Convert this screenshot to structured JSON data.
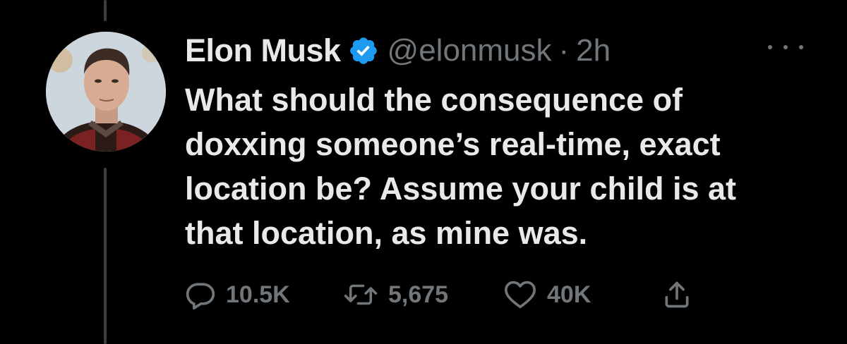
{
  "tweet": {
    "author": {
      "display_name": "Elon Musk",
      "handle": "@elonmusk",
      "verified_icon": "verified-badge-icon",
      "avatar": "profile-photo"
    },
    "separator": "·",
    "timestamp": "2h",
    "more_icon": "more-options-icon",
    "text_lines": [
      "What should the consequence of",
      "doxxing someone’s real-time, exact",
      "location be? Assume your child is at",
      "that location, as mine was."
    ]
  },
  "actions": {
    "reply": {
      "icon": "reply-icon",
      "count": "10.5K"
    },
    "retweet": {
      "icon": "retweet-icon",
      "count": "5,675"
    },
    "like": {
      "icon": "heart-icon",
      "count": "40K"
    },
    "share": {
      "icon": "share-icon"
    }
  },
  "colors": {
    "background": "#000000",
    "text_primary": "#e7e9ea",
    "text_secondary": "#71767b",
    "verified_blue": "#1d9bf0",
    "thread_line": "#3a3e42"
  }
}
